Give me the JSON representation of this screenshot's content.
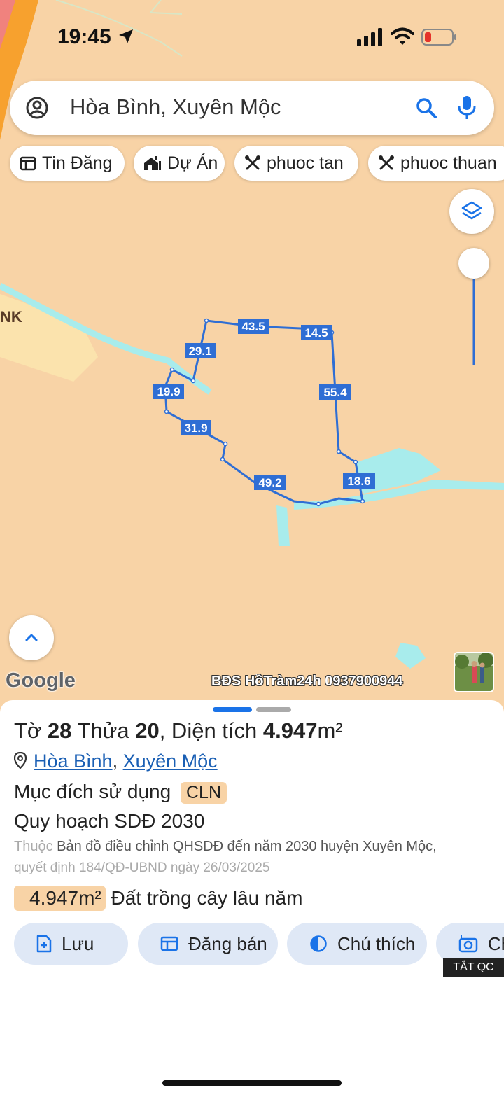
{
  "status_bar": {
    "time": "19:45"
  },
  "search": {
    "query": "Hòa Bình, Xuyên Mộc"
  },
  "chips": [
    {
      "label": "Tin Đăng"
    },
    {
      "label": "Dự Án"
    },
    {
      "label": "phuoc tan"
    },
    {
      "label": "phuoc thuan"
    }
  ],
  "map": {
    "edge_labels": [
      "43.5",
      "14.5",
      "29.1",
      "19.9",
      "55.4",
      "31.9",
      "49.2",
      "18.6"
    ],
    "zone_label": "NK",
    "google_logo": "Google",
    "watermark": "BĐS HồTràm24h 0937900944",
    "colors": {
      "land": "#f8d3a6",
      "water": "#a8ecec",
      "boundary": "#2f6ed4",
      "label_bg": "#2f6ed4",
      "zone": "#fbe3ad"
    }
  },
  "sheet": {
    "title_prefix": "Tờ ",
    "sheet_no": "28",
    "parcel_prefix": " Thửa ",
    "parcel_no": "20",
    "area_prefix": ", Diện tích ",
    "area_value": "4.947",
    "area_unit": "m²",
    "location_commune": "Hòa Bình",
    "location_sep": ",",
    "location_district": "Xuyên Mộc",
    "purpose_label": "Mục đích sử dụng",
    "purpose_code": "CLN",
    "plan_title": "Quy hoạch SDĐ 2030",
    "plan_note_prefix": "Thuộc",
    "plan_note_line1": "Bản đồ điều chỉnh QHSDĐ đến năm 2030 huyện Xuyên Mộc,",
    "plan_note_line2": "quyết định 184/QĐ-UBND ngày 26/03/2025",
    "plan_area_badge": "4.947m²",
    "plan_land_type": "Đất trồng cây lâu năm",
    "actions": [
      {
        "label": "Lưu"
      },
      {
        "label": "Đăng bán"
      },
      {
        "label": "Chú thích"
      },
      {
        "label": "Ch"
      }
    ],
    "ad_badge": "TẮT QC"
  }
}
